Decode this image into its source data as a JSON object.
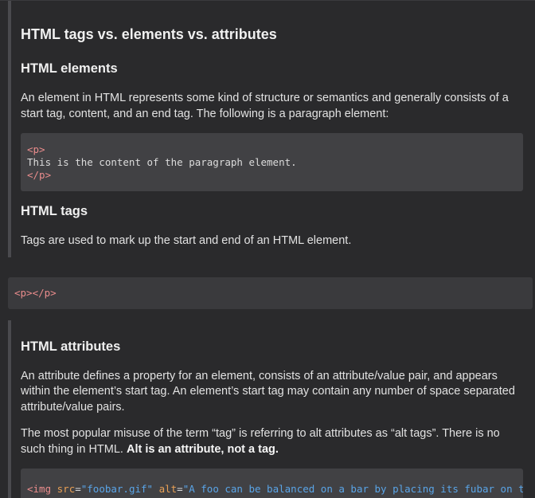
{
  "section_main": {
    "title": "HTML tags vs. elements vs. attributes",
    "elements_heading": "HTML elements",
    "elements_paragraph": "An element in HTML represents some kind of structure or semantics and generally consists of a start tag, content, and an end tag. The following is a paragraph element:",
    "code_open_tag": "<p>",
    "code_content": "This is the content of the paragraph element.",
    "code_close_tag": "</p>",
    "tags_heading": "HTML tags",
    "tags_paragraph": "Tags are used to mark up the start and end of an HTML element."
  },
  "standalone_code": "<p></p>",
  "section_attributes": {
    "heading": "HTML attributes",
    "paragraph1": "An attribute defines a property for an element, consists of an attribute/value pair, and appears within the element’s start tag. An element’s start tag may contain any number of space separated attribute/value pairs.",
    "paragraph2_text": "The most popular misuse of the term “tag” is referring to alt attributes as “alt tags”. There is no such thing in HTML. ",
    "paragraph2_bold": "Alt is an attribute, not a tag.",
    "code": {
      "tag_open": "<img",
      "attr1": "src",
      "eq1": "=",
      "val1": "\"foobar.gif\"",
      "attr2": "alt",
      "eq2": "=",
      "val2": "\"A foo can be balanced on a bar by placing its fubar on the bar's foobar.\"",
      "tag_close": ">"
    }
  },
  "colors": {
    "background": "#2a2a2c",
    "code_background": "#414144",
    "tag": "#e98c8c",
    "attribute": "#e9a055",
    "value": "#5aa5e8"
  }
}
